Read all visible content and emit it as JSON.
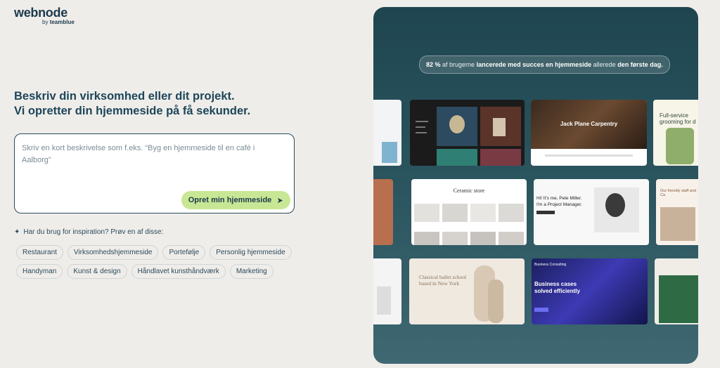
{
  "logo": {
    "brand": "webnode",
    "by": "by",
    "company": "teamblue"
  },
  "headline": {
    "line1": "Beskriv din virksomhed eller dit projekt.",
    "line2": "Vi opretter din hjemmeside på få sekunder."
  },
  "prompt": {
    "placeholder": "Skriv en kort beskrivelse som f.eks. “Byg en hjemmeside til en café i Aalborg”",
    "value": ""
  },
  "create_button": {
    "label": "Opret min hjemmeside",
    "icon": "arrow-right-icon"
  },
  "inspiration": {
    "label": "Har du brug for inspiration? Prøv en af disse:",
    "icon": "sparkle-icon"
  },
  "chips": [
    "Restaurant",
    "Virksomhedshjemmeside",
    "Portefølje",
    "Personlig hjemmeside",
    "Handyman",
    "Kunst & design",
    "Håndlavet kunsthåndværk",
    "Marketing"
  ],
  "stat": {
    "pct": "82 %",
    "t1": " af brugerne ",
    "b1": "lancerede med succes en hjemmeside",
    "t2": " allerede ",
    "b2": "den første dag."
  },
  "templates": {
    "carpentry": "Jack Plane Carpentry",
    "grooming": "Full-service grooming for d",
    "ceramic": "Ceramic store",
    "pm_line1": "Hi! It's me, Pete Miller.",
    "pm_line2": "I'm a Project Manager.",
    "friendly": "Our friendly staff and Ca",
    "ballet": "Classical ballet school based in New York",
    "consulting_title": "Business cases solved efficiently",
    "consulting_brand": "Business Consulting"
  },
  "colors": {
    "accent_button": "#c8e795",
    "panel_bg": "#2c5660",
    "headline": "#1d4659"
  }
}
